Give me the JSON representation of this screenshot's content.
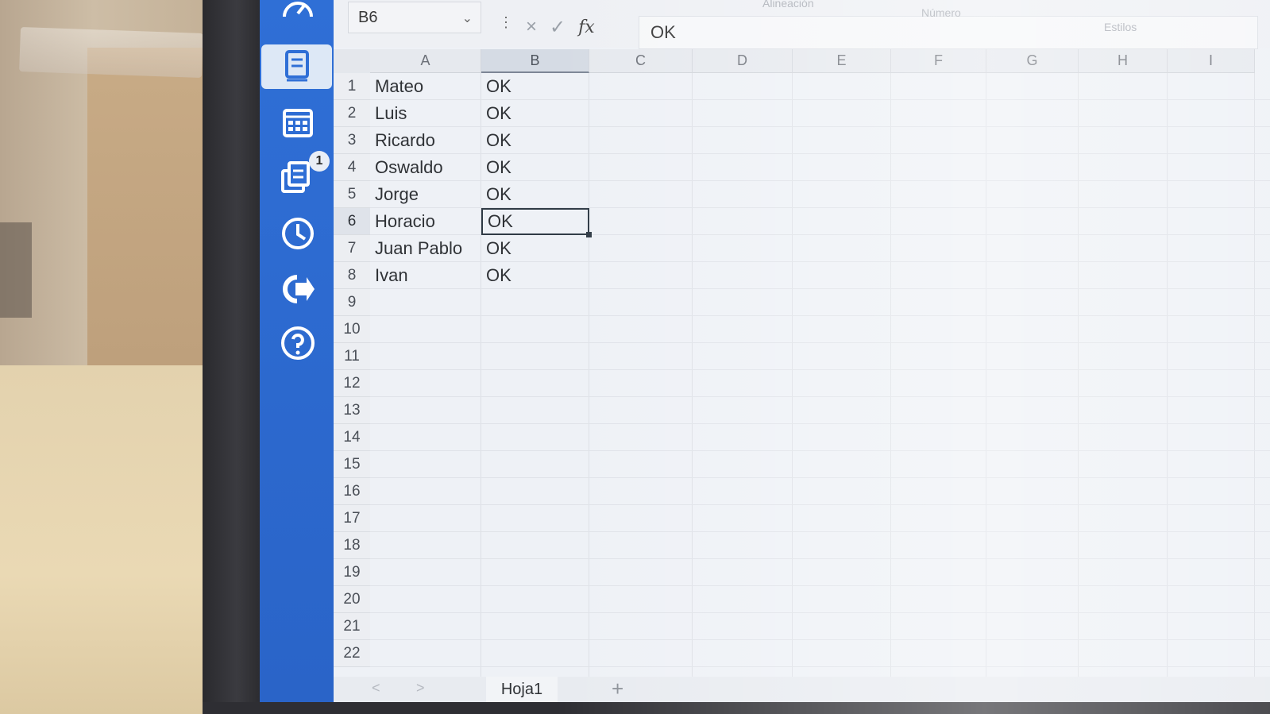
{
  "formula_bar": {
    "cell_ref": "B6",
    "fx_label": "fx",
    "content": "OK",
    "cancel_icon": "×",
    "confirm_icon": "✓"
  },
  "ribbon_hints": {
    "alignment": "Alineación",
    "number": "Número",
    "styles": "Estilos"
  },
  "sidebar": {
    "items": [
      {
        "icon": "dashboard-gauge-icon"
      },
      {
        "icon": "book-icon",
        "active": true
      },
      {
        "icon": "calendar-icon"
      },
      {
        "icon": "documents-icon",
        "badge": "1"
      },
      {
        "icon": "clock-icon"
      },
      {
        "icon": "logout-icon"
      },
      {
        "icon": "help-icon"
      }
    ]
  },
  "grid": {
    "columns": [
      "A",
      "B",
      "C",
      "D",
      "E",
      "F",
      "G",
      "H",
      "I"
    ],
    "selected_column": "B",
    "row_numbers": [
      "1",
      "2",
      "3",
      "4",
      "5",
      "6",
      "7",
      "8",
      "9",
      "10",
      "11",
      "12",
      "13",
      "14",
      "15",
      "16",
      "17",
      "18",
      "19",
      "20",
      "21",
      "22"
    ],
    "selected_row": "6",
    "rows": [
      {
        "a": "Mateo",
        "b": "OK"
      },
      {
        "a": "Luis",
        "b": "OK"
      },
      {
        "a": "Ricardo",
        "b": "OK"
      },
      {
        "a": "Oswaldo",
        "b": "OK"
      },
      {
        "a": "Jorge",
        "b": "OK"
      },
      {
        "a": "Horacio",
        "b": "OK"
      },
      {
        "a": "Juan Pablo",
        "b": "OK"
      },
      {
        "a": "Ivan",
        "b": "OK"
      }
    ]
  },
  "sheet_tabs": {
    "tabs": [
      "Hoja1"
    ],
    "add_label": "+",
    "prev": "<",
    "next": ">"
  },
  "colors": {
    "sidebar_blue": "#2f6fd6",
    "active_cell_border": "#2f3a45"
  }
}
